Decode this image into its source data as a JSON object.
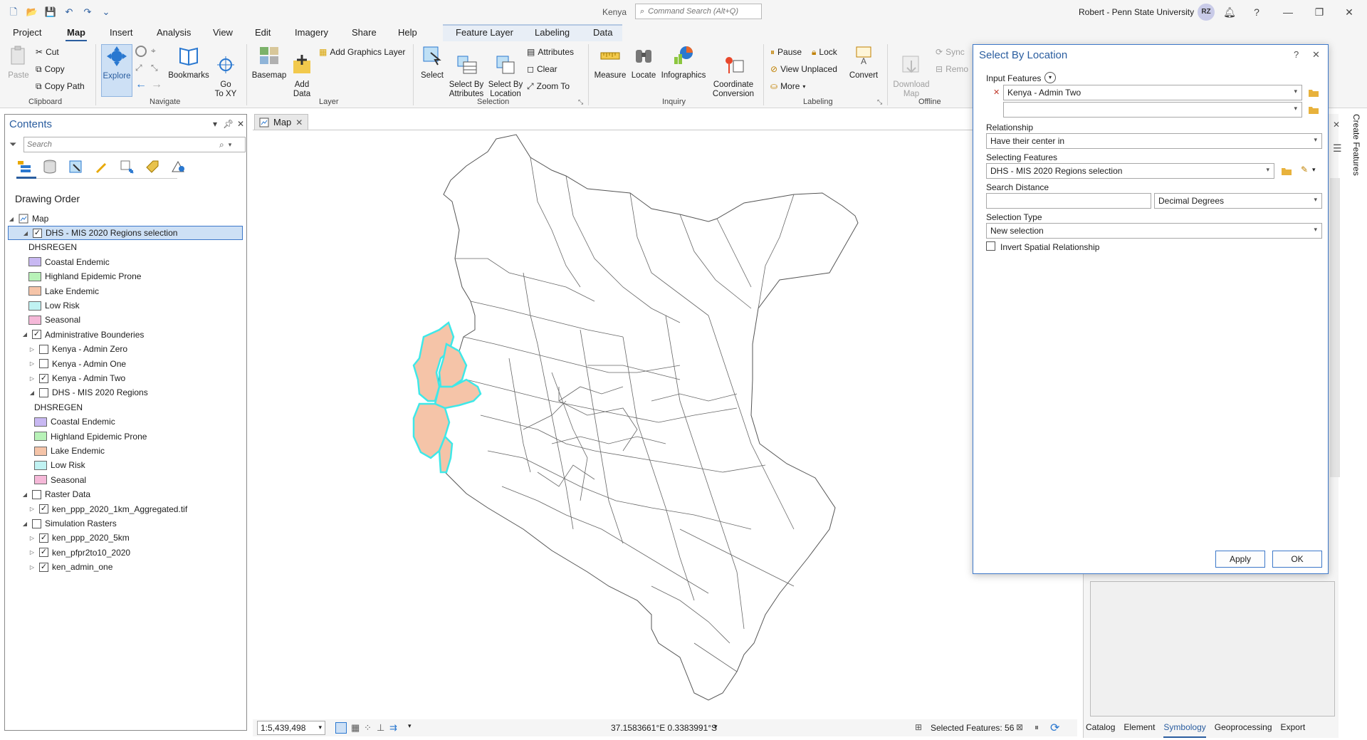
{
  "window": {
    "doc_title": "Kenya",
    "search_placeholder": "Command Search (Alt+Q)",
    "user": "Robert - Penn State University",
    "avatar_initials": "RZ"
  },
  "ribbon_tabs": [
    "Project",
    "Map",
    "Insert",
    "Analysis",
    "View",
    "Edit",
    "Imagery",
    "Share",
    "Help",
    "Feature Layer",
    "Labeling",
    "Data"
  ],
  "active_ribbon_tab": "Map",
  "ribbon": {
    "clipboard": {
      "paste": "Paste",
      "cut": "Cut",
      "copy": "Copy",
      "copy_path": "Copy Path",
      "label": "Clipboard"
    },
    "navigate": {
      "explore": "Explore",
      "bookmarks": "Bookmarks",
      "go_to_xy": "Go\nTo XY",
      "label": "Navigate"
    },
    "layer": {
      "basemap": "Basemap",
      "add_data": "Add\nData",
      "add_graphics_layer": "Add Graphics Layer",
      "label": "Layer"
    },
    "selection": {
      "select": "Select",
      "select_by_attributes": "Select By\nAttributes",
      "select_by_location": "Select By\nLocation",
      "attributes": "Attributes",
      "clear": "Clear",
      "zoom_to": "Zoom To",
      "label": "Selection"
    },
    "inquiry": {
      "measure": "Measure",
      "locate": "Locate",
      "infographics": "Infographics",
      "coordinate_conversion": "Coordinate\nConversion",
      "label": "Inquiry"
    },
    "labeling": {
      "pause": "Pause",
      "lock": "Lock",
      "view_unplaced": "View Unplaced",
      "more": "More",
      "convert": "Convert",
      "label": "Labeling"
    },
    "offline": {
      "download_map": "Download\nMap",
      "sync": "Sync",
      "remove": "Remo",
      "label": "Offline"
    }
  },
  "contents": {
    "title": "Contents",
    "search_placeholder": "Search",
    "drawing_order": "Drawing Order",
    "map_label": "Map",
    "rows": [
      {
        "label": "DHS - MIS 2020 Regions selection",
        "checked": true,
        "level": 1,
        "selected": true
      },
      {
        "label": "DHSREGEN",
        "level": 2,
        "type": "heading"
      },
      {
        "label": "Coastal Endemic",
        "level": 2,
        "type": "legend",
        "color": "#c8b8f2"
      },
      {
        "label": "Highland Epidemic Prone",
        "level": 2,
        "type": "legend",
        "color": "#b8f2b8"
      },
      {
        "label": "Lake Endemic",
        "level": 2,
        "type": "legend",
        "color": "#f5c4a8"
      },
      {
        "label": "Low Risk",
        "level": 2,
        "type": "legend",
        "color": "#c0f2f2"
      },
      {
        "label": "Seasonal",
        "level": 2,
        "type": "legend",
        "color": "#f5b8d8"
      },
      {
        "label": "Administrative Bounderies",
        "checked": true,
        "level": 1
      },
      {
        "label": "Kenya - Admin Zero",
        "checked": false,
        "level": 2
      },
      {
        "label": "Kenya - Admin One",
        "checked": false,
        "level": 2
      },
      {
        "label": "Kenya - Admin Two",
        "checked": true,
        "level": 2
      },
      {
        "label": "DHS - MIS 2020 Regions",
        "checked": false,
        "level": 2,
        "expanded": true
      },
      {
        "label": "DHSREGEN",
        "level": 3,
        "type": "heading"
      },
      {
        "label": "Coastal Endemic",
        "level": 3,
        "type": "legend",
        "color": "#c8b8f2"
      },
      {
        "label": "Highland Epidemic Prone",
        "level": 3,
        "type": "legend",
        "color": "#b8f2b8"
      },
      {
        "label": "Lake Endemic",
        "level": 3,
        "type": "legend",
        "color": "#f5c4a8"
      },
      {
        "label": "Low Risk",
        "level": 3,
        "type": "legend",
        "color": "#c0f2f2"
      },
      {
        "label": "Seasonal",
        "level": 3,
        "type": "legend",
        "color": "#f5b8d8"
      },
      {
        "label": "Raster Data",
        "checked": false,
        "level": 1
      },
      {
        "label": "ken_ppp_2020_1km_Aggregated.tif",
        "checked": true,
        "level": 2
      },
      {
        "label": "Simulation Rasters",
        "checked": false,
        "level": 1
      },
      {
        "label": "ken_ppp_2020_5km",
        "checked": true,
        "level": 2
      },
      {
        "label": "ken_pfpr2to10_2020",
        "checked": true,
        "level": 2
      },
      {
        "label": "ken_admin_one",
        "checked": true,
        "level": 2
      }
    ]
  },
  "map": {
    "tab_label": "Map",
    "scale": "1:5,439,498",
    "coordinates": "37.1583661°E 0.3383991°S",
    "selected_features": "Selected Features: 56"
  },
  "dialog": {
    "title": "Select By Location",
    "input_features_label": "Input Features",
    "input_features_value": "Kenya - Admin Two",
    "input_features_value2": "",
    "relationship_label": "Relationship",
    "relationship_value": "Have their center in",
    "selecting_features_label": "Selecting Features",
    "selecting_features_value": "DHS - MIS 2020 Regions selection",
    "search_distance_label": "Search Distance",
    "search_distance_value": "",
    "search_distance_unit": "Decimal Degrees",
    "selection_type_label": "Selection Type",
    "selection_type_value": "New selection",
    "invert_label": "Invert Spatial Relationship",
    "invert_checked": false,
    "apply": "Apply",
    "ok": "OK"
  },
  "right_pane": {
    "vertical_tab": "Create Features",
    "bottom_tabs": [
      "Catalog",
      "Element",
      "Symbology",
      "Geoprocessing",
      "Export"
    ],
    "active_bottom_tab": "Symbology"
  },
  "colors": {
    "accent": "#2a5d9f",
    "selection_outline": "#3fe8e8",
    "lake_endemic": "#f5c4a8"
  }
}
